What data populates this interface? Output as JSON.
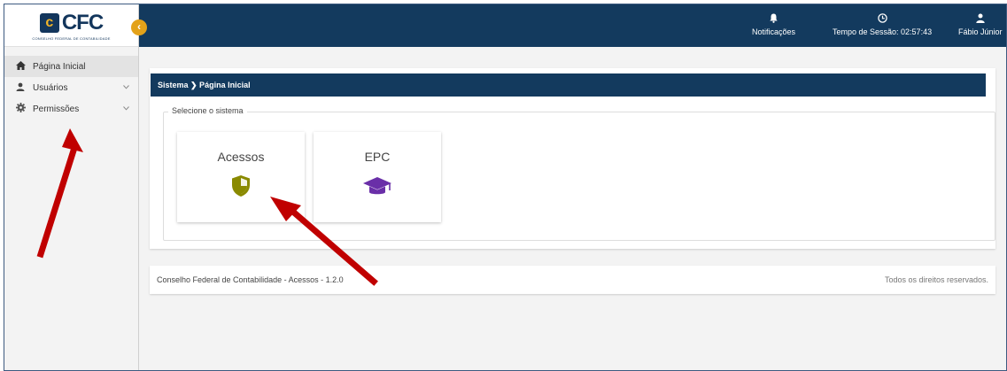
{
  "sidebar": {
    "logo": {
      "text": "CFC",
      "mark": "c",
      "subtitle": "CONSELHO FEDERAL DE CONTABILIDADE"
    },
    "items": [
      {
        "label": "Página Inicial",
        "icon": "home-icon",
        "active": true
      },
      {
        "label": "Usuários",
        "icon": "user-icon",
        "expandable": true
      },
      {
        "label": "Permissões",
        "icon": "gear-icon",
        "expandable": true
      }
    ]
  },
  "collapse_button": {
    "icon": "chevron-left-icon",
    "glyph": "‹"
  },
  "topbar": {
    "notifications": {
      "label": "Notificações",
      "icon": "bell-icon"
    },
    "session": {
      "label": "Tempo de Sessão: 02:57:43",
      "icon": "clock-icon"
    },
    "user": {
      "label": "Fábio Júnior",
      "icon": "user-icon"
    }
  },
  "breadcrumb": {
    "text": "Sistema ❯ Página Inicial"
  },
  "system_select": {
    "legend": "Selecione o sistema",
    "tiles": [
      {
        "label": "Acessos",
        "icon": "shield-icon",
        "color": "#8a8a00"
      },
      {
        "label": "EPC",
        "icon": "graduation-cap-icon",
        "color": "#6a2fa8"
      }
    ]
  },
  "footer": {
    "left": "Conselho Federal de Contabilidade - Acessos - 1.2.0",
    "right": "Todos os direitos reservados."
  },
  "colors": {
    "primary": "#133a5e",
    "accent": "#e3a21a",
    "annotation": "#c00000"
  }
}
